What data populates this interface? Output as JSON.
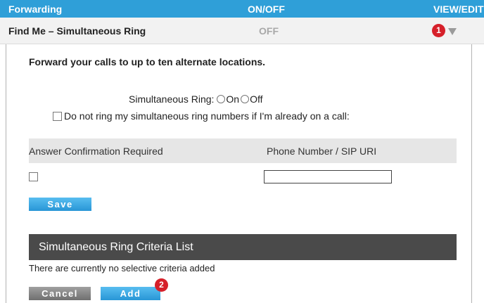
{
  "header": {
    "col1": "Forwarding",
    "col2": "ON/OFF",
    "col3": "VIEW/EDIT"
  },
  "row": {
    "title": "Find Me – Simultaneous Ring",
    "state": "OFF",
    "badge": "1",
    "expand_icon": "triangle-down-icon"
  },
  "panel": {
    "intro": "Forward your calls to up to ten alternate locations.",
    "sim_ring_label": "Simultaneous Ring:",
    "option_on": "On",
    "option_off": "Off",
    "do_not_ring_label": "Do not ring my simultaneous ring numbers if I'm already on a call:",
    "table_headers": [
      "Answer Confirmation Required",
      "Phone Number / SIP URI"
    ],
    "phone_value": "",
    "save_label": "Save",
    "criteria_title": "Simultaneous Ring Criteria List",
    "no_criteria": "There are currently no selective criteria added",
    "cancel_label": "Cancel",
    "add_label": "Add",
    "add_badge": "2"
  },
  "colors": {
    "accent": "#2f9fd8",
    "badge": "#d6202a",
    "criteria_bar": "#4a4a4a",
    "cancel": "#8a8a8a"
  }
}
